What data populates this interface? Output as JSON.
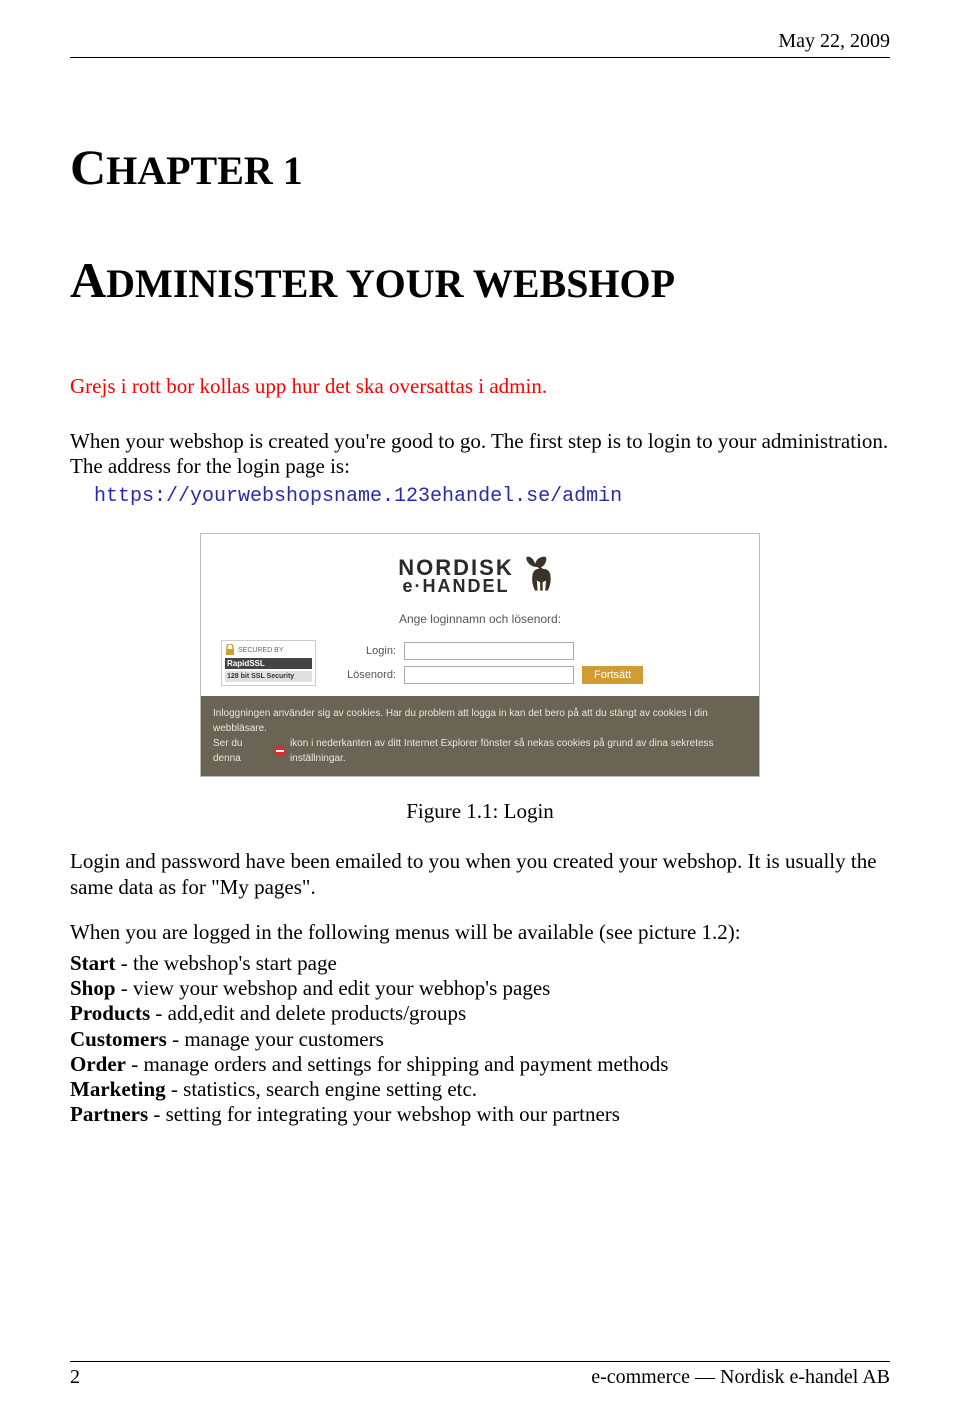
{
  "header": {
    "date": "May 22, 2009"
  },
  "chapter": {
    "label_word": "C",
    "label_rest": "HAPTER 1",
    "title_word": "A",
    "title_rest": "DMINISTER YOUR WEBSHOP"
  },
  "red_note": "Grejs i rott bor kollas upp hur det ska oversattas i admin.",
  "intro1": "When your webshop is created you're good to go. The first step is to login to your administration. The address for the login page is:",
  "login_url": "https://yourwebshopsname.123ehandel.se/admin",
  "login_form": {
    "logo_line1": "NORDISK",
    "logo_line2": "e·HANDEL",
    "subtitle": "Ange loginnamn och lösenord:",
    "login_label": "Login:",
    "password_label": "Lösenord:",
    "button": "Fortsätt",
    "ssl_secured_by": "SECURED BY",
    "ssl_brand": "RapidSSL",
    "ssl_bits": "128 bit SSL Security",
    "notice1": "Inloggningen använder sig av cookies. Har du problem att logga in kan det bero på att du stängt av cookies i din webbläsare.",
    "notice2a": "Ser du denna",
    "notice2b": "ikon i nederkanten av ditt Internet Explorer fönster så nekas cookies på grund av dina sekretess inställningar."
  },
  "figure_caption": "Figure 1.1: Login",
  "para2": "Login and password have been emailed to you when you created your webshop. It is usually the same data as for \"My pages\".",
  "para3": "When you are logged in the following menus will be available (see picture 1.2):",
  "menus": [
    {
      "term": "Start",
      "desc": " - the webshop's start page"
    },
    {
      "term": "Shop",
      "desc": " - view your webshop and edit your webhop's pages"
    },
    {
      "term": "Products",
      "desc": " - add,edit and delete products/groups"
    },
    {
      "term": "Customers",
      "desc": " - manage your customers"
    },
    {
      "term": "Order",
      "desc": " - manage orders and settings for shipping and payment methods"
    },
    {
      "term": "Marketing",
      "desc": " - statistics, search engine setting etc."
    },
    {
      "term": "Partners",
      "desc": " - setting for integrating your webshop with our partners"
    }
  ],
  "footer": {
    "page": "2",
    "right": "e-commerce — Nordisk e-handel AB"
  }
}
